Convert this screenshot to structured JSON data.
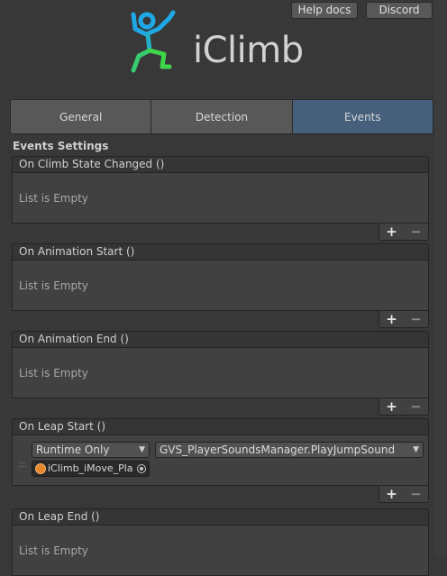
{
  "header": {
    "help_label": "Help docs",
    "discord_label": "Discord"
  },
  "logo": {
    "text": "iClimb"
  },
  "tabs": [
    {
      "label": "General",
      "active": false
    },
    {
      "label": "Detection",
      "active": false
    },
    {
      "label": "Events",
      "active": true
    }
  ],
  "section": {
    "title": "Events Settings"
  },
  "events": [
    {
      "title": "On Climb State Changed ()",
      "empty_text": "List is Empty"
    },
    {
      "title": "On Animation Start ()",
      "empty_text": "List is Empty"
    },
    {
      "title": "On Animation End ()",
      "empty_text": "List is Empty"
    },
    {
      "title": "On Leap Start ()",
      "listener": {
        "runtime_mode": "Runtime Only",
        "function": "GVS_PlayerSoundsManager.PlayJumpSound",
        "target_object": "iClimb_iMove_Pla"
      }
    },
    {
      "title": "On Leap End ()",
      "empty_text": "List is Empty"
    }
  ],
  "controls": {
    "add": "+",
    "remove": "−"
  },
  "colors": {
    "active_tab": "#46607c",
    "background": "#383838",
    "logo_blue": "#1fa8e6",
    "logo_green": "#3ed64a"
  }
}
